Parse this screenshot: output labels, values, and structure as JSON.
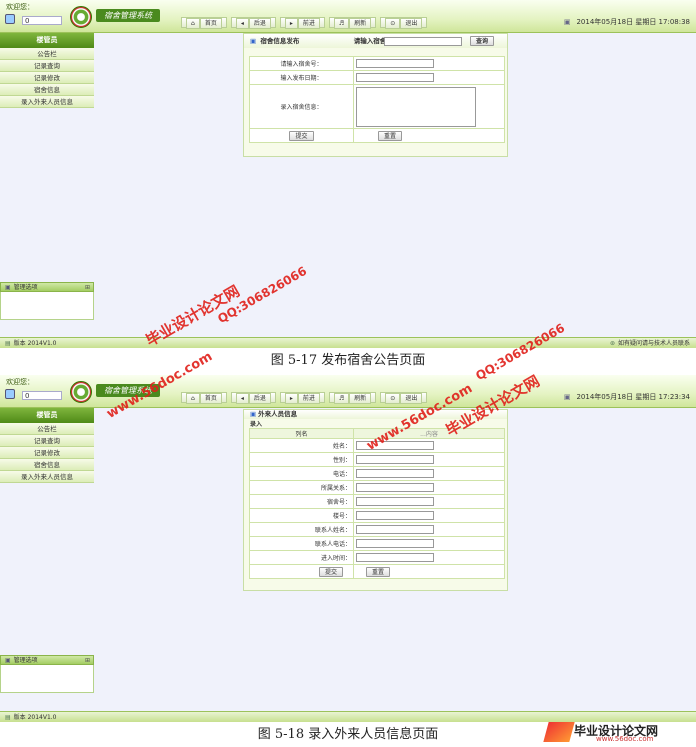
{
  "common": {
    "welcome": "欢迎您：",
    "user_value": "0",
    "brand": "宿舍管理系统",
    "nav": [
      "首页",
      "后退",
      "前进",
      "刷新",
      "退出"
    ],
    "sidebar_title": "楼管员",
    "sidebar_items": [
      "公告栏",
      "记录查询",
      "记录修改",
      "宿舍信息",
      "录入外来人员信息"
    ],
    "panel_title": "管理选项",
    "footer_left": "版本 2014V1.0",
    "footer_right": "如有疑问请与技术人员联系"
  },
  "shot1": {
    "date": "2014年05月18日 星期日 17:08:38",
    "form_title": "宿舍信息发布",
    "search_label": "请输入宿舍号：",
    "search_button": "查询",
    "fields": [
      "请输入宿舍号：",
      "输入发布日期：",
      "录入宿舍信息："
    ],
    "submit": "提交",
    "reset": "重置",
    "caption": "图 5-17 发布宿舍公告页面"
  },
  "shot2": {
    "date": "2014年05月18日 星期日 17:23:34",
    "form_title": "外来人员信息",
    "sub_title": "录入",
    "col_header": "列名",
    "col_header2": "...内容",
    "fields": [
      "姓名：",
      "性别：",
      "电话：",
      "所属关系：",
      "宿舍号：",
      "楼号：",
      "联系人姓名：",
      "联系人电话：",
      "进入时间："
    ],
    "submit": "提交",
    "reset": "重置",
    "caption": "图 5-18 录入外来人员信息页面"
  },
  "watermarks": {
    "site": "毕业设计论文网",
    "url": "www.56doc.com",
    "qq": "QQ:306826066"
  },
  "corner_logo": {
    "title": "毕业设计论文网",
    "url": "www.56doc.com"
  }
}
